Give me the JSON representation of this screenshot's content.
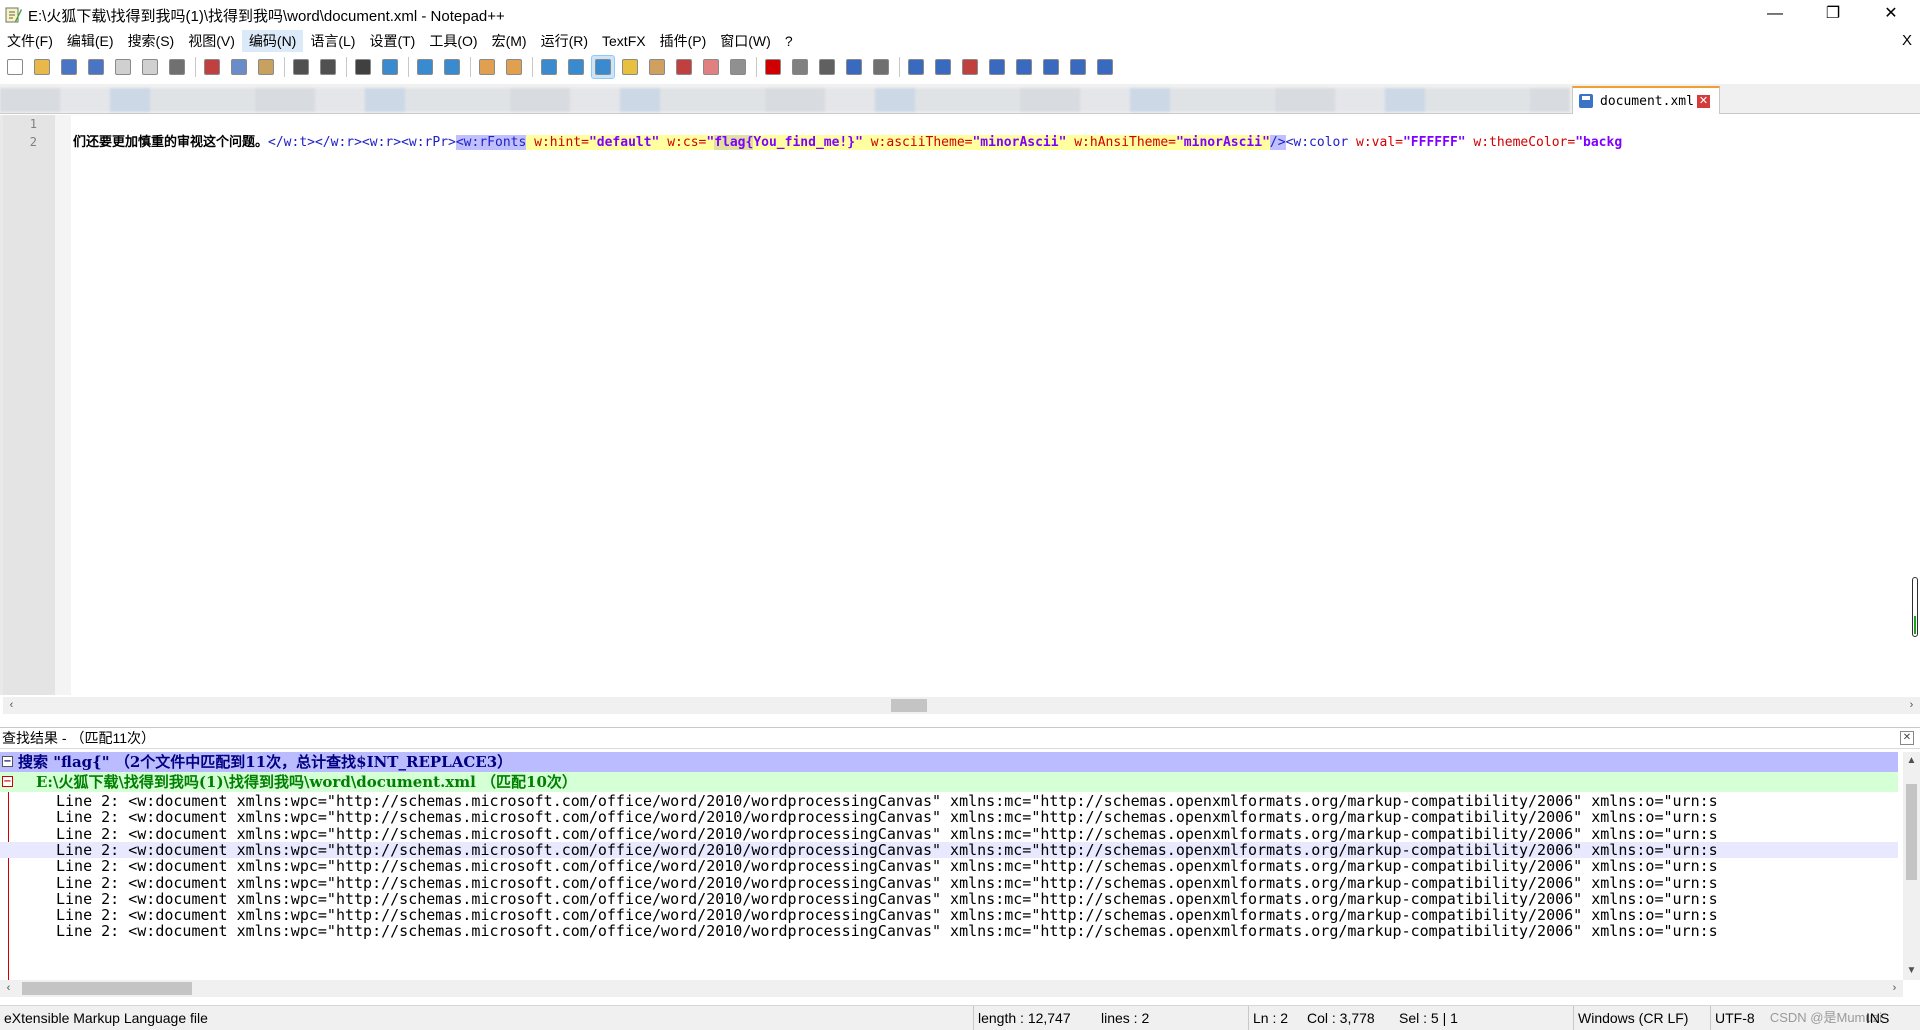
{
  "window": {
    "title": "E:\\火狐下载\\找得到我吗(1)\\找得到我吗\\word\\document.xml - Notepad++",
    "buttons": {
      "minimize": "—",
      "maximize": "❐",
      "close": "✕"
    }
  },
  "menu": {
    "items": [
      "文件(F)",
      "编辑(E)",
      "搜索(S)",
      "视图(V)",
      "编码(N)",
      "语言(L)",
      "设置(T)",
      "工具(O)",
      "宏(M)",
      "运行(R)",
      "TextFX",
      "插件(P)",
      "窗口(W)",
      "?"
    ],
    "active_index": 4,
    "close_label": "X"
  },
  "toolbar": {
    "icons": [
      {
        "name": "new-file-icon",
        "color": "#ffffff"
      },
      {
        "name": "open-file-icon",
        "color": "#e8b84a"
      },
      {
        "name": "save-icon",
        "color": "#4a74c4"
      },
      {
        "name": "save-all-icon",
        "color": "#4a74c4"
      },
      {
        "name": "close-icon",
        "color": "#d0d0d0"
      },
      {
        "name": "close-all-icon",
        "color": "#d0d0d0"
      },
      {
        "name": "print-icon",
        "color": "#707070"
      },
      {
        "name": "sep"
      },
      {
        "name": "cut-icon",
        "color": "#c04040"
      },
      {
        "name": "copy-icon",
        "color": "#6a8cc8"
      },
      {
        "name": "paste-icon",
        "color": "#c8a060"
      },
      {
        "name": "sep"
      },
      {
        "name": "undo-icon",
        "color": "#505050"
      },
      {
        "name": "redo-icon",
        "color": "#505050"
      },
      {
        "name": "sep"
      },
      {
        "name": "find-icon",
        "color": "#404040"
      },
      {
        "name": "replace-icon",
        "color": "#3a8ad0"
      },
      {
        "name": "sep"
      },
      {
        "name": "zoom-in-icon",
        "color": "#3a8ad0"
      },
      {
        "name": "zoom-out-icon",
        "color": "#3a8ad0"
      },
      {
        "name": "sep"
      },
      {
        "name": "sync-vertical-icon",
        "color": "#e0a050"
      },
      {
        "name": "sync-horizontal-icon",
        "color": "#e0a050"
      },
      {
        "name": "sep"
      },
      {
        "name": "word-wrap-icon",
        "color": "#3a8ad0"
      },
      {
        "name": "show-all-chars-icon",
        "color": "#3a8ad0"
      },
      {
        "name": "indent-guide-icon",
        "color": "#3a8ad0",
        "selected": true
      },
      {
        "name": "user-language-icon",
        "color": "#e8c040"
      },
      {
        "name": "document-map-icon",
        "color": "#d0a060"
      },
      {
        "name": "function-list-icon",
        "color": "#c04040"
      },
      {
        "name": "folder-workspace-icon",
        "color": "#e08080"
      },
      {
        "name": "monitoring-icon",
        "color": "#909090"
      },
      {
        "name": "sep"
      },
      {
        "name": "record-macro-icon",
        "color": "#d00000"
      },
      {
        "name": "stop-macro-icon",
        "color": "#808080"
      },
      {
        "name": "play-macro-icon",
        "color": "#606060"
      },
      {
        "name": "run-macro-multiple-icon",
        "color": "#3a6ac0"
      },
      {
        "name": "save-macro-icon",
        "color": "#707070"
      },
      {
        "name": "sep"
      },
      {
        "name": "textfx-insert-icon",
        "color": "#3a6ac0"
      },
      {
        "name": "textfx-list-icon",
        "color": "#3a6ac0"
      },
      {
        "name": "textfx-table-icon",
        "color": "#c04040"
      },
      {
        "name": "textfx-collapse-icon",
        "color": "#3a6ac0"
      },
      {
        "name": "arrow-up-icon",
        "color": "#3a6ac0"
      },
      {
        "name": "arrow-down-icon",
        "color": "#3a6ac0"
      },
      {
        "name": "textfx-sort-icon",
        "color": "#3a6ac0"
      },
      {
        "name": "textfx-grid-icon",
        "color": "#3a6ac0"
      }
    ]
  },
  "tab": {
    "label": "document.xml",
    "close": "✕"
  },
  "editor": {
    "line_numbers": [
      "1",
      "2"
    ],
    "line2": {
      "text": "们还要更加慎重的审视这个问题。",
      "tag1": "</w:t></w:r><w:r><w:rPr>",
      "tag_sel": "<w:rFonts",
      "a1": " w:hint=",
      "v1": "\"default\"",
      "a2": " w:cs=",
      "v2q": "\"",
      "v2hit": "flag{",
      "v2rest": "You_find_me!}\"",
      "a3": " w:asciiTheme=",
      "v3": "\"minorAscii\"",
      "a4": " w:hAnsiTheme=",
      "v4": "\"minorAscii\"",
      "tag_end": "/>",
      "tag2": "<w:color",
      "a5": " w:val=",
      "v5": "\"FFFFFF\"",
      "a6": " w:themeColor=",
      "v6": "\"backg"
    }
  },
  "find_results": {
    "header": "查找结果 - （匹配11次）",
    "close": "✕",
    "search_line": "搜索 \"flag{\" （2个文件中匹配到11次，总计查找$INT_REPLACE3）",
    "file_line": "E:\\火狐下载\\找得到我吗(1)\\找得到我吗\\word\\document.xml （匹配10次）",
    "hits": [
      "Line 2: <w:document xmlns:wpc=\"http://schemas.microsoft.com/office/word/2010/wordprocessingCanvas\" xmlns:mc=\"http://schemas.openxmlformats.org/markup-compatibility/2006\" xmlns:o=\"urn:s",
      "Line 2: <w:document xmlns:wpc=\"http://schemas.microsoft.com/office/word/2010/wordprocessingCanvas\" xmlns:mc=\"http://schemas.openxmlformats.org/markup-compatibility/2006\" xmlns:o=\"urn:s",
      "Line 2: <w:document xmlns:wpc=\"http://schemas.microsoft.com/office/word/2010/wordprocessingCanvas\" xmlns:mc=\"http://schemas.openxmlformats.org/markup-compatibility/2006\" xmlns:o=\"urn:s",
      "Line 2: <w:document xmlns:wpc=\"http://schemas.microsoft.com/office/word/2010/wordprocessingCanvas\" xmlns:mc=\"http://schemas.openxmlformats.org/markup-compatibility/2006\" xmlns:o=\"urn:s",
      "Line 2: <w:document xmlns:wpc=\"http://schemas.microsoft.com/office/word/2010/wordprocessingCanvas\" xmlns:mc=\"http://schemas.openxmlformats.org/markup-compatibility/2006\" xmlns:o=\"urn:s",
      "Line 2: <w:document xmlns:wpc=\"http://schemas.microsoft.com/office/word/2010/wordprocessingCanvas\" xmlns:mc=\"http://schemas.openxmlformats.org/markup-compatibility/2006\" xmlns:o=\"urn:s",
      "Line 2: <w:document xmlns:wpc=\"http://schemas.microsoft.com/office/word/2010/wordprocessingCanvas\" xmlns:mc=\"http://schemas.openxmlformats.org/markup-compatibility/2006\" xmlns:o=\"urn:s",
      "Line 2: <w:document xmlns:wpc=\"http://schemas.microsoft.com/office/word/2010/wordprocessingCanvas\" xmlns:mc=\"http://schemas.openxmlformats.org/markup-compatibility/2006\" xmlns:o=\"urn:s",
      "Line 2: <w:document xmlns:wpc=\"http://schemas.microsoft.com/office/word/2010/wordprocessingCanvas\" xmlns:mc=\"http://schemas.openxmlformats.org/markup-compatibility/2006\" xmlns:o=\"urn:s"
    ],
    "current_hit_index": 3
  },
  "status": {
    "file_type": "eXtensible Markup Language file",
    "length": "length : 12,747",
    "lines": "lines : 2",
    "ln": "Ln : 2",
    "col": "Col : 3,778",
    "sel": "Sel : 5 | 1",
    "eol": "Windows (CR LF)",
    "encoding": "UTF-8",
    "mode": "INS",
    "watermark": "CSDN @是Mumuzi"
  }
}
